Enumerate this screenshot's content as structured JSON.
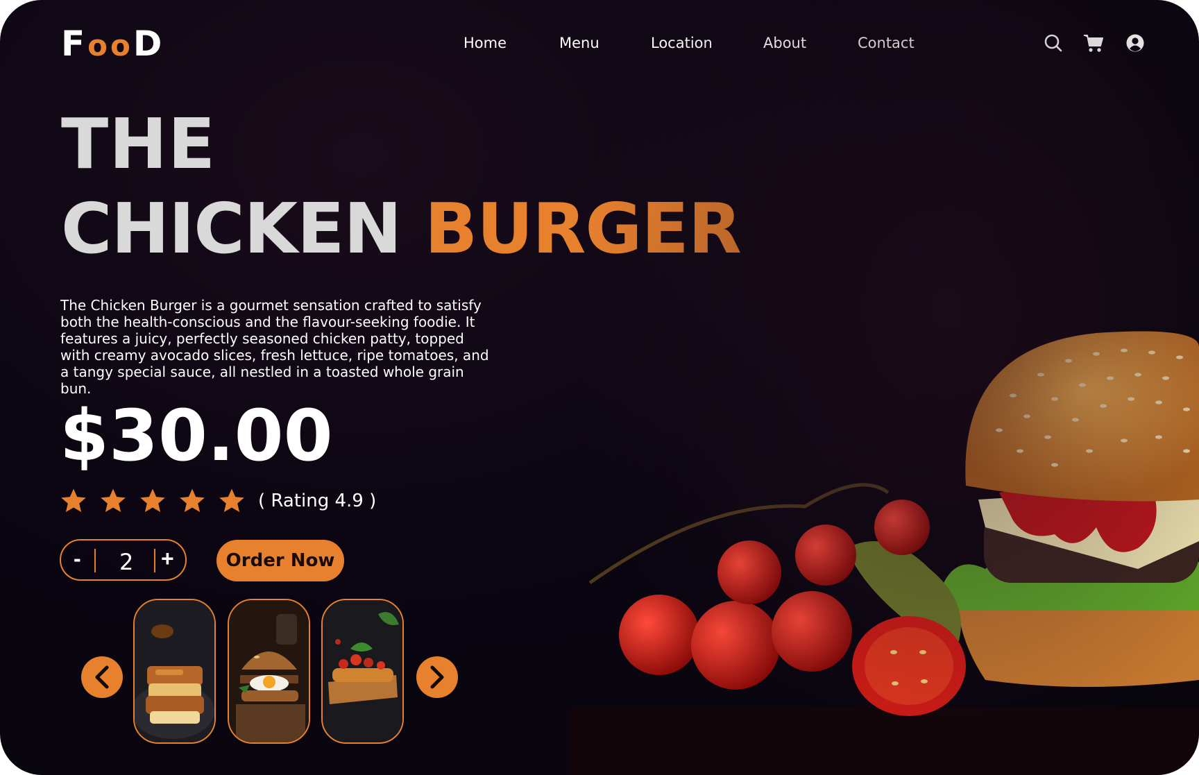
{
  "brand": {
    "letters": [
      "F",
      "oo",
      "D"
    ]
  },
  "nav": {
    "items": [
      "Home",
      "Menu",
      "Location",
      "About",
      "Contact"
    ]
  },
  "header_icons": [
    "search-icon",
    "cart-icon",
    "user-account-icon"
  ],
  "hero": {
    "title_line1": "THE",
    "title_line2_white": "CHICKEN",
    "title_line2_accent": "BURGER",
    "description": "The Chicken Burger is a gourmet sensation crafted to satisfy both the health-conscious and the flavour-seeking foodie. It features a juicy, perfectly seasoned chicken patty, topped with creamy avocado slices, fresh lettuce, ripe tomatoes, and a tangy special sauce, all nestled in a toasted whole grain bun.",
    "price": "$30.00",
    "stars": 5,
    "rating_text": "( Rating 4.9 )"
  },
  "quantity": {
    "minus": "-",
    "value": "2",
    "plus": "+"
  },
  "order_button": "Order Now",
  "carousel": {
    "prev_icon": "chevron-left-icon",
    "next_icon": "chevron-right-icon",
    "items": [
      "french-toast-image",
      "egg-burger-image",
      "bruschetta-image"
    ]
  },
  "colors": {
    "accent": "#e8812e",
    "background": "#0b0612",
    "title_gray": "#d9d9d9",
    "text": "#ffffff"
  }
}
